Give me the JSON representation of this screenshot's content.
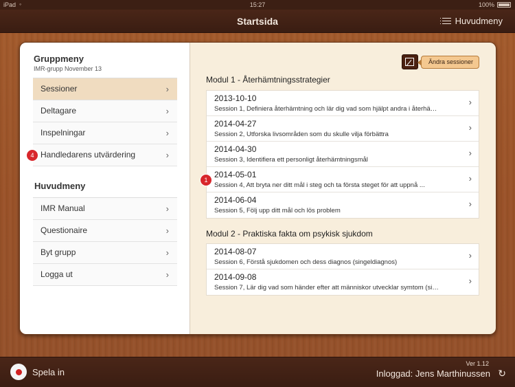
{
  "statusbar": {
    "carrier": "iPad",
    "time": "15:27",
    "battery": "100%"
  },
  "navbar": {
    "title": "Startsida",
    "menu_label": "Huvudmeny"
  },
  "left": {
    "group_title": "Gruppmeny",
    "group_subtitle": "IMR-grupp November 13",
    "group_items": [
      {
        "label": "Sessioner",
        "badge": ""
      },
      {
        "label": "Deltagare",
        "badge": ""
      },
      {
        "label": "Inspelningar",
        "badge": ""
      },
      {
        "label": "Handledarens utvärdering",
        "badge": "4"
      }
    ],
    "main_title": "Huvudmeny",
    "main_items": [
      {
        "label": "IMR Manual"
      },
      {
        "label": "Questionaire"
      },
      {
        "label": "Byt grupp"
      },
      {
        "label": "Logga ut"
      }
    ]
  },
  "right": {
    "edit_label": "Ändra sessioner",
    "modules": [
      {
        "title": "Modul 1 - Återhämtningsstrategier",
        "sessions": [
          {
            "date": "2013-10-10",
            "desc": "Session 1, Definiera återhämtning och lär dig vad som hjälpt andra i återhä…",
            "badge": ""
          },
          {
            "date": "2014-04-27",
            "desc": "Session 2, Utforska livsområden som du skulle vilja förbättra",
            "badge": ""
          },
          {
            "date": "2014-04-30",
            "desc": "Session 3, Identifiera ett personligt återhämtningsmål",
            "badge": ""
          },
          {
            "date": "2014-05-01",
            "desc": "Session 4, Att bryta ner ditt mål i steg och ta första steget för att uppnå ...",
            "badge": "1"
          },
          {
            "date": "2014-06-04",
            "desc": "Session 5, Följ upp ditt mål och lös problem",
            "badge": ""
          }
        ]
      },
      {
        "title": "Modul 2 - Praktiska fakta om psykisk sjukdom",
        "sessions": [
          {
            "date": "2014-08-07",
            "desc": "Session 6, Förstå sjukdomen och dess diagnos (singeldiagnos)",
            "badge": ""
          },
          {
            "date": "2014-09-08",
            "desc": "Session 7, Lär dig vad som händer efter att människor utvecklar symtom (si…",
            "badge": ""
          }
        ]
      }
    ]
  },
  "bottombar": {
    "record_label": "Spela in",
    "version": "Ver 1.12",
    "login": "Inloggad: Jens Marthinussen"
  },
  "icons": {
    "chevron": "chevron-right-icon",
    "menu": "list-menu-icon",
    "edit": "edit-icon",
    "record": "record-icon",
    "refresh": "refresh-icon"
  }
}
